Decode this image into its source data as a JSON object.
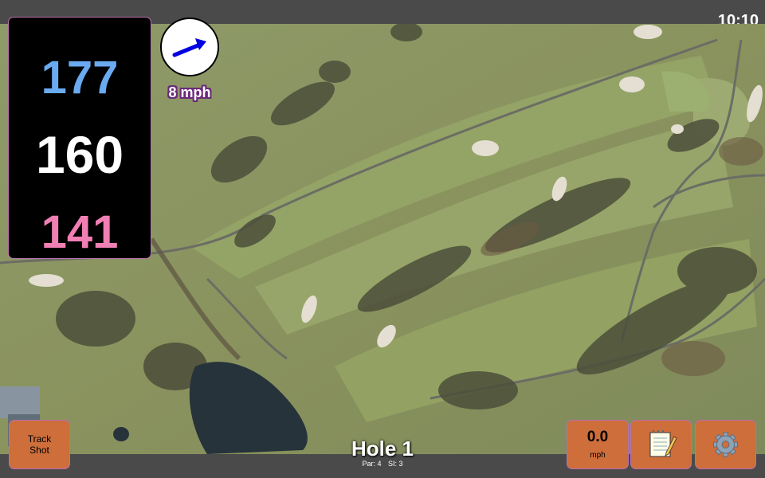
{
  "status_bar": {
    "time": "10:10"
  },
  "distances": {
    "back": "177",
    "middle": "160",
    "front": "141"
  },
  "wind": {
    "speed": "8 mph",
    "icon": "wind-direction-arrow-icon"
  },
  "track_button": {
    "label_line1": "Track",
    "label_line2": "Shot"
  },
  "speed_button": {
    "value": "0.0",
    "unit": "mph"
  },
  "notes_button": {
    "icon": "notepad-icon"
  },
  "settings_button": {
    "icon": "gear-icon"
  },
  "hole": {
    "title": "Hole 1",
    "par": "Par: 4",
    "si": "SI: 3"
  },
  "colors": {
    "back": "#6aaaf0",
    "middle": "#ffffff",
    "front": "#f07fb4",
    "button": "#cd6e3b",
    "wind_text_outline": "#6b2a7a"
  }
}
